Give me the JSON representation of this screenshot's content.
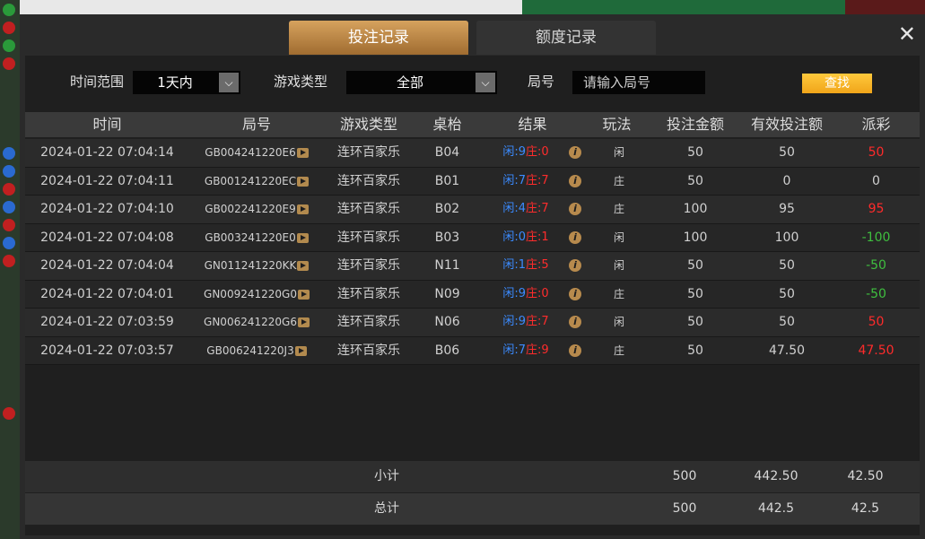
{
  "tabs": {
    "bet_record": "投注记录",
    "quota_record": "额度记录"
  },
  "close_symbol": "✕",
  "filters": {
    "time_range_label": "时间范围",
    "time_range_value": "1天内",
    "game_type_label": "游戏类型",
    "game_type_value": "全部",
    "round_label": "局号",
    "round_placeholder": "请输入局号",
    "search_button": "查找"
  },
  "table": {
    "headers": [
      "时间",
      "局号",
      "游戏类型",
      "桌枱",
      "结果",
      "玩法",
      "投注金额",
      "有效投注额",
      "派彩"
    ],
    "result_labels": {
      "player": "闲",
      "banker": "庄"
    },
    "rows": [
      {
        "time": "2024-01-22 07:04:14",
        "round": "GB004241220E6",
        "type": "连环百家乐",
        "table": "B04",
        "player": "9",
        "banker": "0",
        "play": "闲",
        "amount": "50",
        "valid": "50",
        "payout": "50",
        "payout_sign": "pos"
      },
      {
        "time": "2024-01-22 07:04:11",
        "round": "GB001241220EC",
        "type": "连环百家乐",
        "table": "B01",
        "player": "7",
        "banker": "7",
        "play": "庄",
        "amount": "50",
        "valid": "0",
        "payout": "0",
        "payout_sign": "zero"
      },
      {
        "time": "2024-01-22 07:04:10",
        "round": "GB002241220E9",
        "type": "连环百家乐",
        "table": "B02",
        "player": "4",
        "banker": "7",
        "play": "庄",
        "amount": "100",
        "valid": "95",
        "payout": "95",
        "payout_sign": "pos"
      },
      {
        "time": "2024-01-22 07:04:08",
        "round": "GB003241220E0",
        "type": "连环百家乐",
        "table": "B03",
        "player": "0",
        "banker": "1",
        "play": "闲",
        "amount": "100",
        "valid": "100",
        "payout": "-100",
        "payout_sign": "neg"
      },
      {
        "time": "2024-01-22 07:04:04",
        "round": "GN011241220KK",
        "type": "连环百家乐",
        "table": "N11",
        "player": "1",
        "banker": "5",
        "play": "闲",
        "amount": "50",
        "valid": "50",
        "payout": "-50",
        "payout_sign": "neg"
      },
      {
        "time": "2024-01-22 07:04:01",
        "round": "GN009241220G0",
        "type": "连环百家乐",
        "table": "N09",
        "player": "9",
        "banker": "0",
        "play": "庄",
        "amount": "50",
        "valid": "50",
        "payout": "-50",
        "payout_sign": "neg"
      },
      {
        "time": "2024-01-22 07:03:59",
        "round": "GN006241220G6",
        "type": "连环百家乐",
        "table": "N06",
        "player": "9",
        "banker": "7",
        "play": "闲",
        "amount": "50",
        "valid": "50",
        "payout": "50",
        "payout_sign": "pos"
      },
      {
        "time": "2024-01-22 07:03:57",
        "round": "GB006241220J3",
        "type": "连环百家乐",
        "table": "B06",
        "player": "7",
        "banker": "9",
        "play": "庄",
        "amount": "50",
        "valid": "47.50",
        "payout": "47.50",
        "payout_sign": "pos"
      }
    ]
  },
  "subtotal": {
    "label": "小计",
    "amount": "500",
    "valid": "442.50",
    "payout": "42.50"
  },
  "total": {
    "label": "总计",
    "amount": "500",
    "valid": "442.5",
    "payout": "42.5"
  },
  "colors": {
    "accent_tab": "#c58b45",
    "search_button": "#f7b52a",
    "player": "#3b8bff",
    "banker": "#ff2c2c",
    "win": "#ff2b2b",
    "loss": "#3fbf3f"
  }
}
